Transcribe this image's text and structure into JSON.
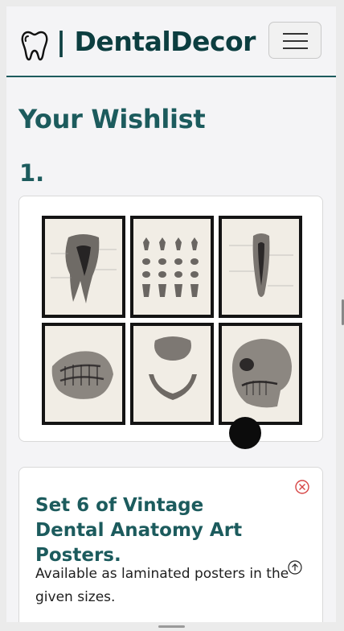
{
  "header": {
    "brand_label": "| DentalDecor",
    "logo_icon": "tooth-icon",
    "menu_icon": "hamburger-menu-icon"
  },
  "main": {
    "title": "Your Wishlist",
    "items": [
      {
        "number": "1.",
        "title": "Set 6 of Vintage Dental Anatomy Art Posters.",
        "description": "Available as laminated posters in the given sizes.",
        "remove_icon": "close-circle-icon",
        "poster_subjects": [
          "molar-cross-section",
          "teeth-chart",
          "tooth-root-section",
          "lower-jaw-teeth",
          "mandible-and-maxilla",
          "skull-side-view"
        ]
      }
    ]
  },
  "colors": {
    "brand": "#0c3e40",
    "accent": "#1c5b5d",
    "remove": "#d64545",
    "page_bg": "#f4f4f6"
  }
}
